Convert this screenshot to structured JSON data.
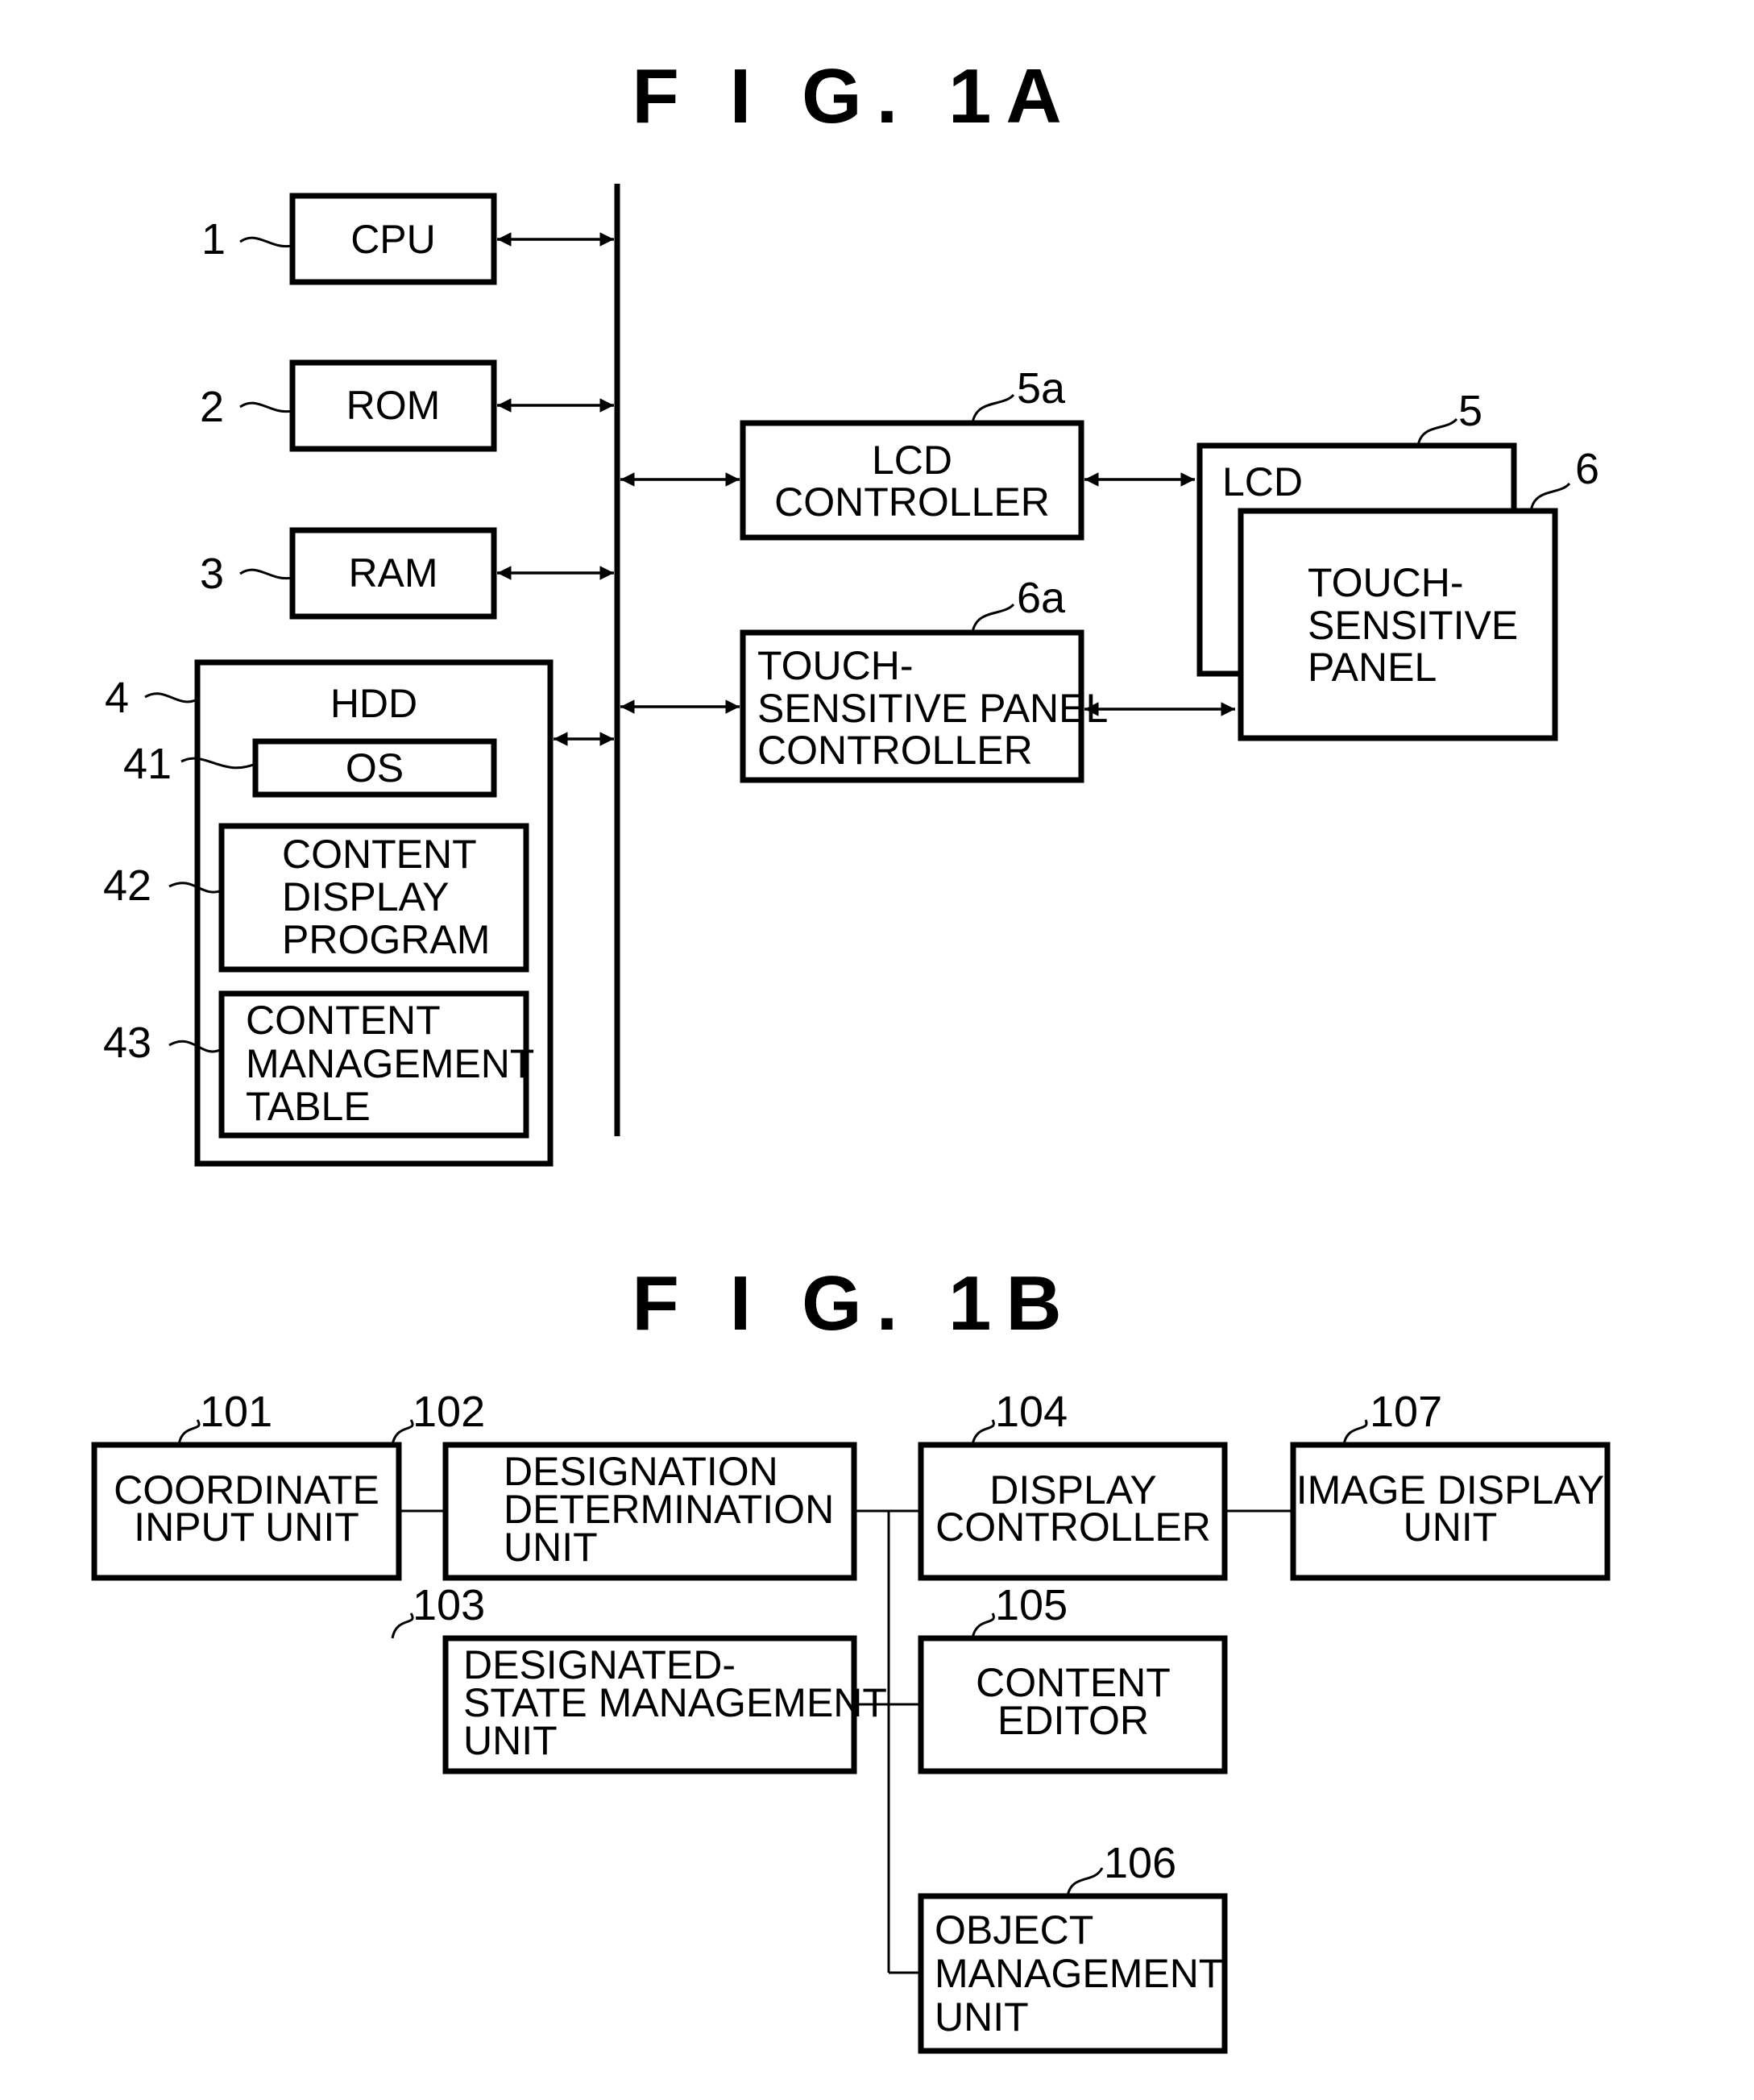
{
  "fig1a": {
    "title": "F I G. 1A",
    "cpu": {
      "ref": "1",
      "lines": [
        "CPU"
      ]
    },
    "rom": {
      "ref": "2",
      "lines": [
        "ROM"
      ]
    },
    "ram": {
      "ref": "3",
      "lines": [
        "RAM"
      ]
    },
    "hdd": {
      "ref": "4",
      "lines": [
        "HDD"
      ]
    },
    "os": {
      "ref": "41",
      "lines": [
        "OS"
      ]
    },
    "content_display_program": {
      "ref": "42",
      "lines": [
        "CONTENT",
        "DISPLAY",
        "PROGRAM"
      ]
    },
    "content_management_table": {
      "ref": "43",
      "lines": [
        "CONTENT",
        "MANAGEMENT",
        "TABLE"
      ]
    },
    "lcd_controller": {
      "ref": "5a",
      "lines": [
        "LCD",
        "CONTROLLER"
      ]
    },
    "touch_panel_controller": {
      "ref": "6a",
      "lines": [
        "TOUCH-",
        "SENSITIVE PANEL",
        "CONTROLLER"
      ]
    },
    "lcd": {
      "ref": "5",
      "lines": [
        "LCD"
      ]
    },
    "touch_panel": {
      "ref": "6",
      "lines": [
        "TOUCH-",
        "SENSITIVE",
        "PANEL"
      ]
    }
  },
  "fig1b": {
    "title": "F I G. 1B",
    "coordinate_input_unit": {
      "ref": "101",
      "lines": [
        "COORDINATE",
        "INPUT UNIT"
      ]
    },
    "designation_determination_unit": {
      "ref": "102",
      "lines": [
        "DESIGNATION",
        "DETERMINATION",
        "UNIT"
      ]
    },
    "designated_state_management_unit": {
      "ref": "103",
      "lines": [
        "DESIGNATED-",
        "STATE MANAGEMENT",
        "UNIT"
      ]
    },
    "display_controller": {
      "ref": "104",
      "lines": [
        "DISPLAY",
        "CONTROLLER"
      ]
    },
    "content_editor": {
      "ref": "105",
      "lines": [
        "CONTENT",
        "EDITOR"
      ]
    },
    "object_management_unit": {
      "ref": "106",
      "lines": [
        "OBJECT",
        "MANAGEMENT",
        "UNIT"
      ]
    },
    "image_display_unit": {
      "ref": "107",
      "lines": [
        "IMAGE DISPLAY",
        "UNIT"
      ]
    }
  }
}
